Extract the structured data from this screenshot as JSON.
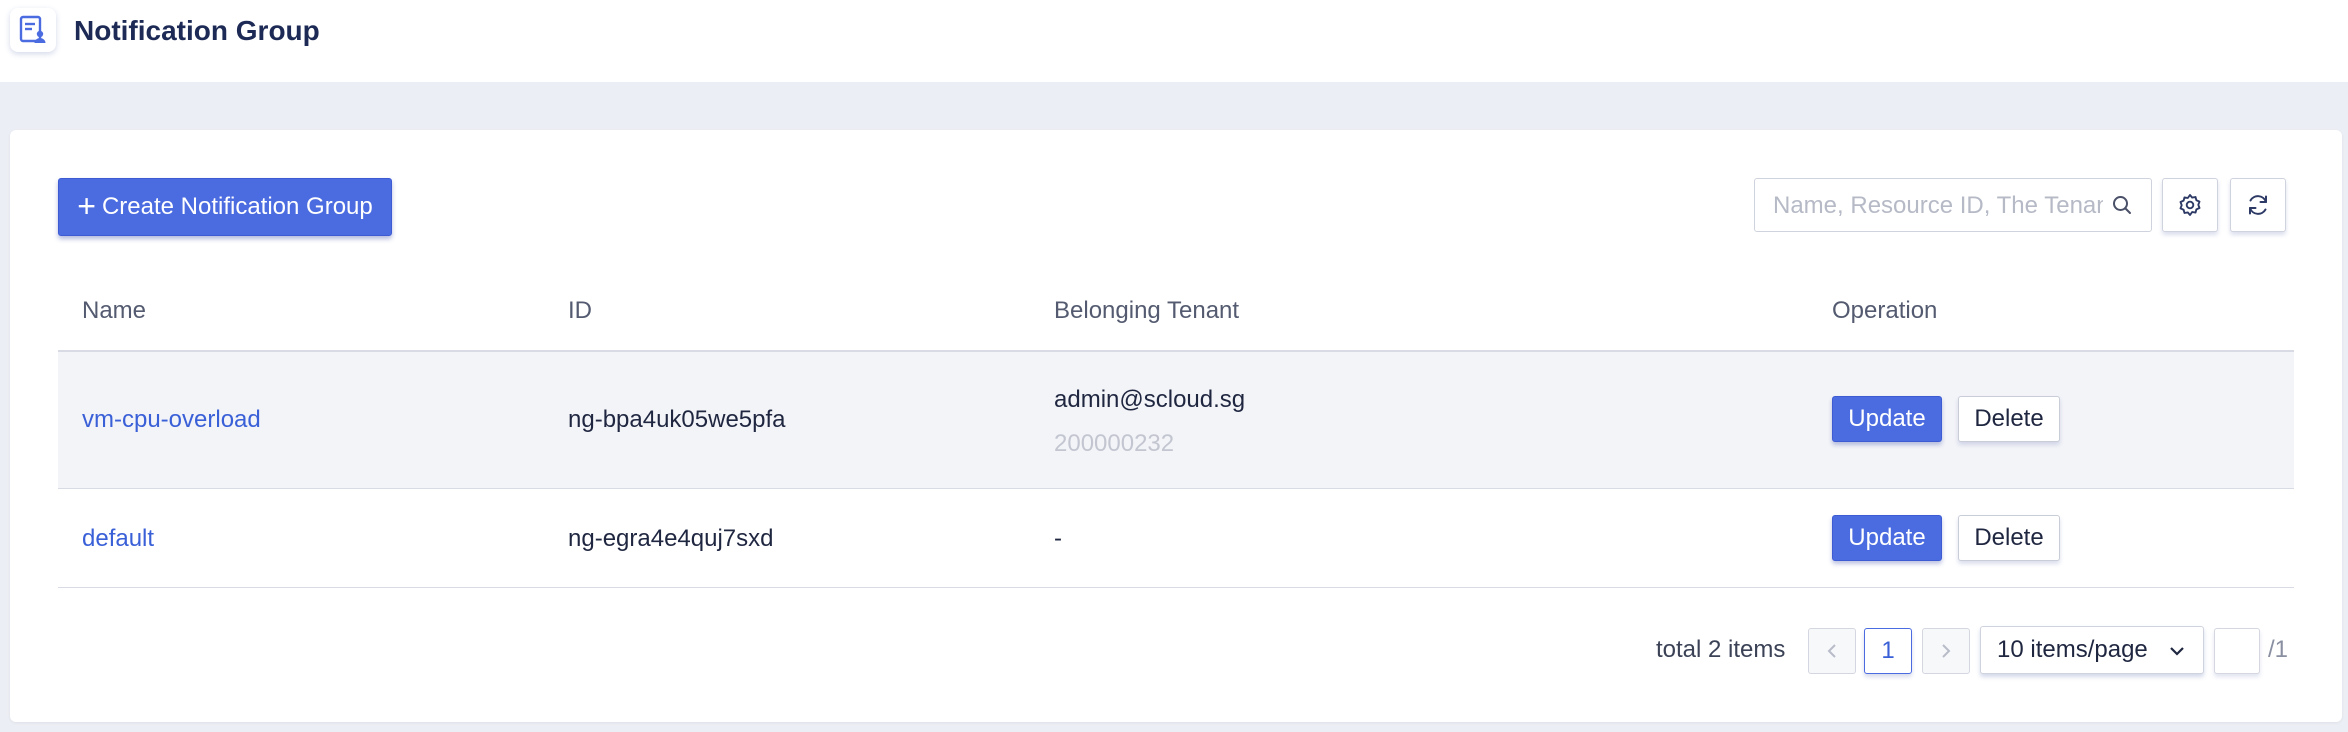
{
  "header": {
    "title": "Notification Group",
    "logo_icon": "document-user-icon"
  },
  "toolbar": {
    "create_label": "Create Notification Group",
    "search_placeholder": "Name, Resource ID, The Tenant",
    "settings_icon": "gear-icon",
    "refresh_icon": "refresh-icon"
  },
  "table": {
    "columns": [
      "Name",
      "ID",
      "Belonging Tenant",
      "Operation"
    ],
    "rows": [
      {
        "name": "vm-cpu-overload",
        "id": "ng-bpa4uk05we5pfa",
        "tenant": "admin@scloud.sg",
        "tenant_id": "200000232",
        "update": "Update",
        "delete": "Delete"
      },
      {
        "name": "default",
        "id": "ng-egra4e4quj7sxd",
        "tenant": "-",
        "tenant_id": "",
        "update": "Update",
        "delete": "Delete"
      }
    ]
  },
  "pagination": {
    "total_text": "total 2 items",
    "current_page": "1",
    "page_size": "10 items/page",
    "total_pages": "/1"
  },
  "colors": {
    "primary": "#4b6be0",
    "link": "#3a60d8",
    "background": "#eceef5"
  }
}
